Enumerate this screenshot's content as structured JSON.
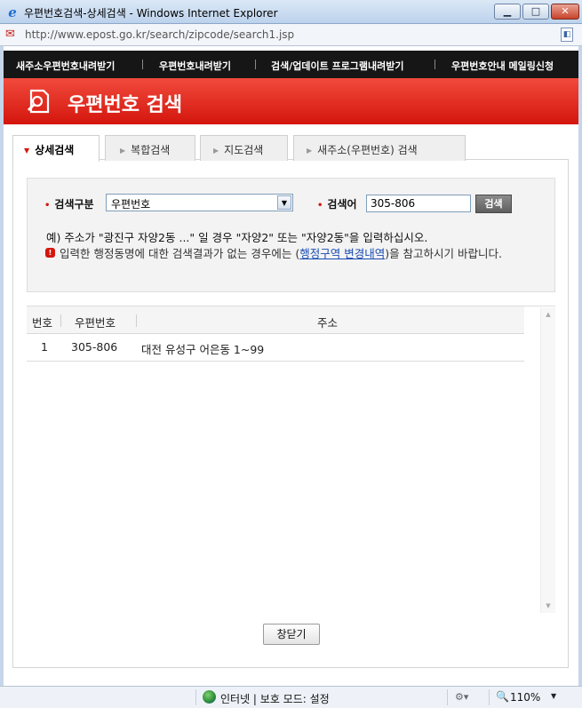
{
  "window": {
    "title": "우편번호검색-상세검색 - Windows Internet Explorer",
    "minimize": "▁",
    "maximize": "□",
    "close": "✕"
  },
  "address": {
    "url": "http://www.epost.go.kr/search/zipcode/search1.jsp"
  },
  "topnav": {
    "items": [
      "새주소우편번호내려받기",
      "우편번호내려받기",
      "검색/업데이트 프로그램내려받기",
      "우편번호안내 메일링신청"
    ]
  },
  "banner": {
    "title": "우편번호 검색"
  },
  "tabs": [
    {
      "label": "상세검색",
      "active": true
    },
    {
      "label": "복합검색",
      "active": false
    },
    {
      "label": "지도검색",
      "active": false
    },
    {
      "label": "새주소(우편번호) 검색",
      "active": false
    }
  ],
  "search": {
    "type_label": "검색구분",
    "type_value": "우편번호",
    "keyword_label": "검색어",
    "keyword_value": "305-806",
    "button_label": "검색",
    "example": "예) 주소가 \"광진구 자양2동 ...\" 일 경우 \"자양2\" 또는 \"자양2동\"을 입력하십시오.",
    "notice_before": "입력한 행정동명에 대한 검색결과가 없는 경우에는 (",
    "notice_link": "행정구역 변경내역",
    "notice_after": ")을 참고하시기 바랍니다."
  },
  "table": {
    "headers": [
      "번호",
      "우편번호",
      "주소"
    ],
    "rows": [
      {
        "no": "1",
        "zipcode": "305-806",
        "address": "대전 유성구 어은동 1~99"
      }
    ]
  },
  "close_button": "창닫기",
  "status": {
    "zone": "인터넷 | 보호 모드: 설정",
    "zoom": "110%"
  }
}
